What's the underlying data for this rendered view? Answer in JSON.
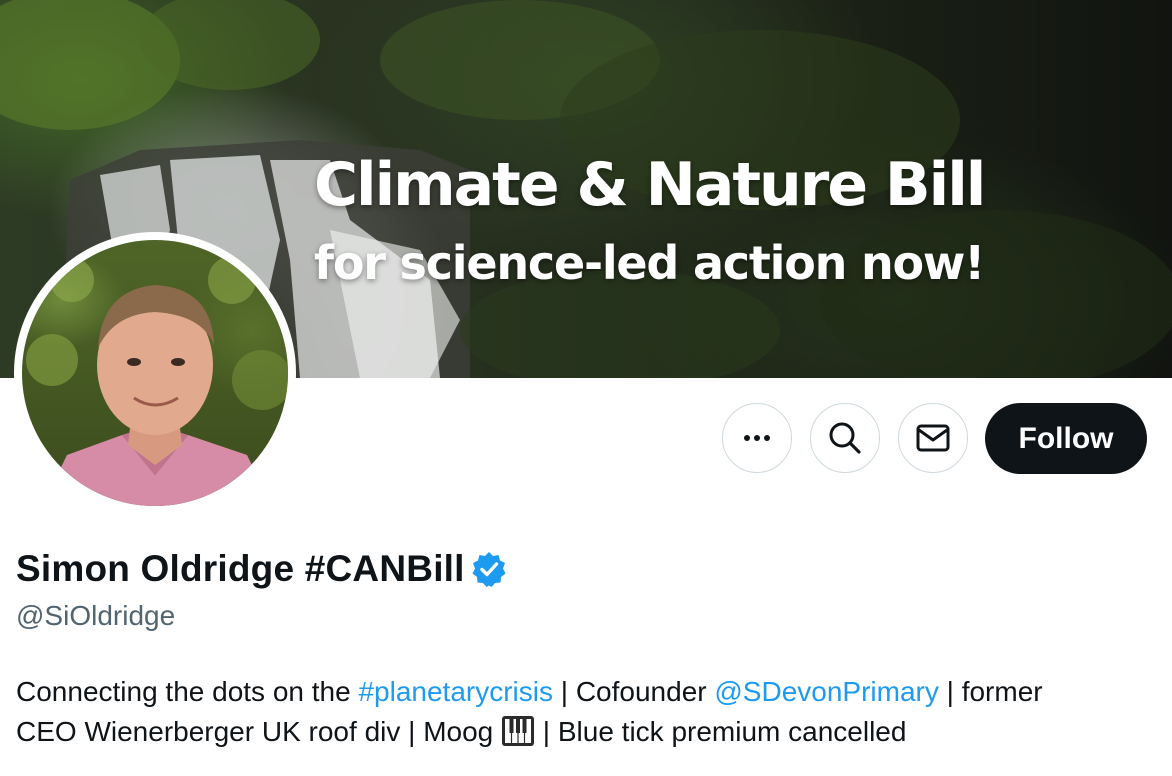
{
  "banner": {
    "title": "Climate & Nature Bill",
    "subtitle": "for science-led action now!"
  },
  "profile": {
    "display_name": "Simon Oldridge #CANBill",
    "handle": "@SiOldridge",
    "verified": true,
    "verified_color": "#1d9bf0"
  },
  "actions": {
    "more_icon": "more-horizontal-icon",
    "search_icon": "search-icon",
    "message_icon": "envelope-icon",
    "follow_label": "Follow"
  },
  "bio": {
    "part1": "Connecting the dots on the ",
    "hashtag": "#planetarycrisis",
    "part2": " | Cofounder ",
    "mention": "@SDevonPrimary",
    "part3": " | former",
    "part4": "CEO Wienerberger UK roof div | Moog ",
    "emoji_icon": "piano-keys-icon",
    "part5": " | Blue tick premium cancelled"
  },
  "colors": {
    "link": "#1d9bf0",
    "follow_bg": "#0f1419",
    "handle": "#536471"
  }
}
